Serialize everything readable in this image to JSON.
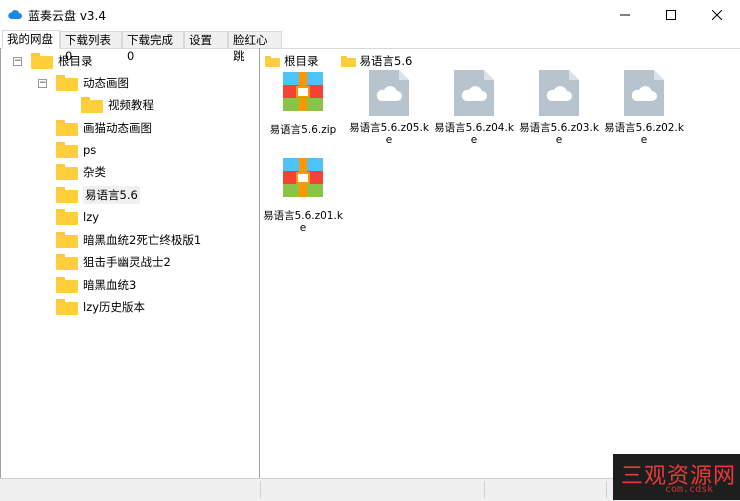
{
  "window": {
    "title": "蓝奏云盘 v3.4"
  },
  "tabs": [
    "我的网盘",
    "下载列表0",
    "下载完成0",
    "设置",
    "脸红心跳"
  ],
  "tree": [
    {
      "label": "根目录"
    },
    {
      "label": "动态画图"
    },
    {
      "label": "视频教程"
    },
    {
      "label": "画猫动态画图"
    },
    {
      "label": "ps"
    },
    {
      "label": "杂类"
    },
    {
      "label": "易语言5.6"
    },
    {
      "label": "lzy"
    },
    {
      "label": "暗黑血统2死亡终极版1"
    },
    {
      "label": "狙击手幽灵战士2"
    },
    {
      "label": "暗黑血统3"
    },
    {
      "label": "lzy历史版本"
    }
  ],
  "breadcrumb": [
    "根目录",
    "易语言5.6"
  ],
  "files": [
    {
      "name": "易语言5.6.zip",
      "icon": "archive-icon"
    },
    {
      "name": "易语言5.6.z05.ke",
      "icon": "cloud-file-icon"
    },
    {
      "name": "易语言5.6.z04.ke",
      "icon": "cloud-file-icon"
    },
    {
      "name": "易语言5.6.z03.ke",
      "icon": "cloud-file-icon"
    },
    {
      "name": "易语言5.6.z02.ke",
      "icon": "cloud-file-icon"
    },
    {
      "name": "易语言5.6.z01.ke",
      "icon": "archive-icon"
    }
  ],
  "watermark": {
    "text": "三观资源网",
    "sub": "com.cdsk"
  },
  "colors": {
    "folder": "#ffcf3b",
    "cloud_file": "#b7c3cd",
    "accent": "#1e88e5"
  }
}
